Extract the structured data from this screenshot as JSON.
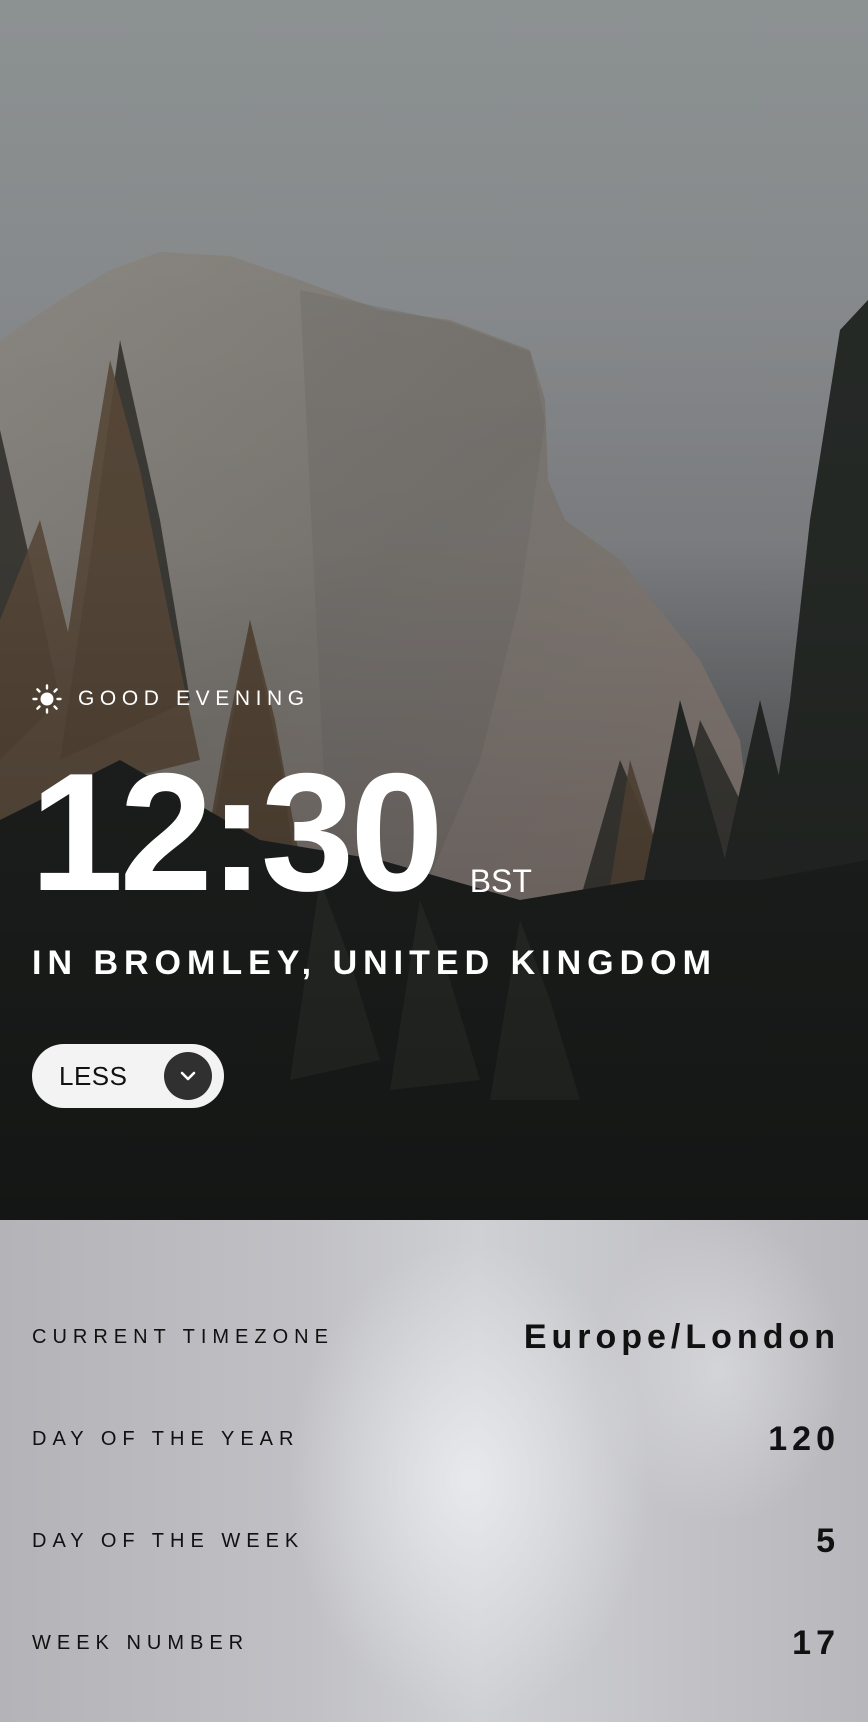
{
  "greeting": {
    "icon": "sun-icon",
    "text": "GOOD EVENING"
  },
  "clock": {
    "time": "12:30",
    "abbreviation": "BST"
  },
  "location": "IN BROMLEY, UNITED KINGDOM",
  "toggle": {
    "label": "LESS",
    "icon": "chevron-down-icon"
  },
  "details": [
    {
      "label": "CURRENT TIMEZONE",
      "value": "Europe/London"
    },
    {
      "label": "DAY OF THE YEAR",
      "value": "120"
    },
    {
      "label": "DAY OF THE WEEK",
      "value": "5"
    },
    {
      "label": "WEEK NUMBER",
      "value": "17"
    }
  ],
  "colors": {
    "text_light": "#ffffff",
    "button_bg": "#f3f3f3",
    "chevron_bg": "#303030",
    "panel_text": "#111111"
  }
}
